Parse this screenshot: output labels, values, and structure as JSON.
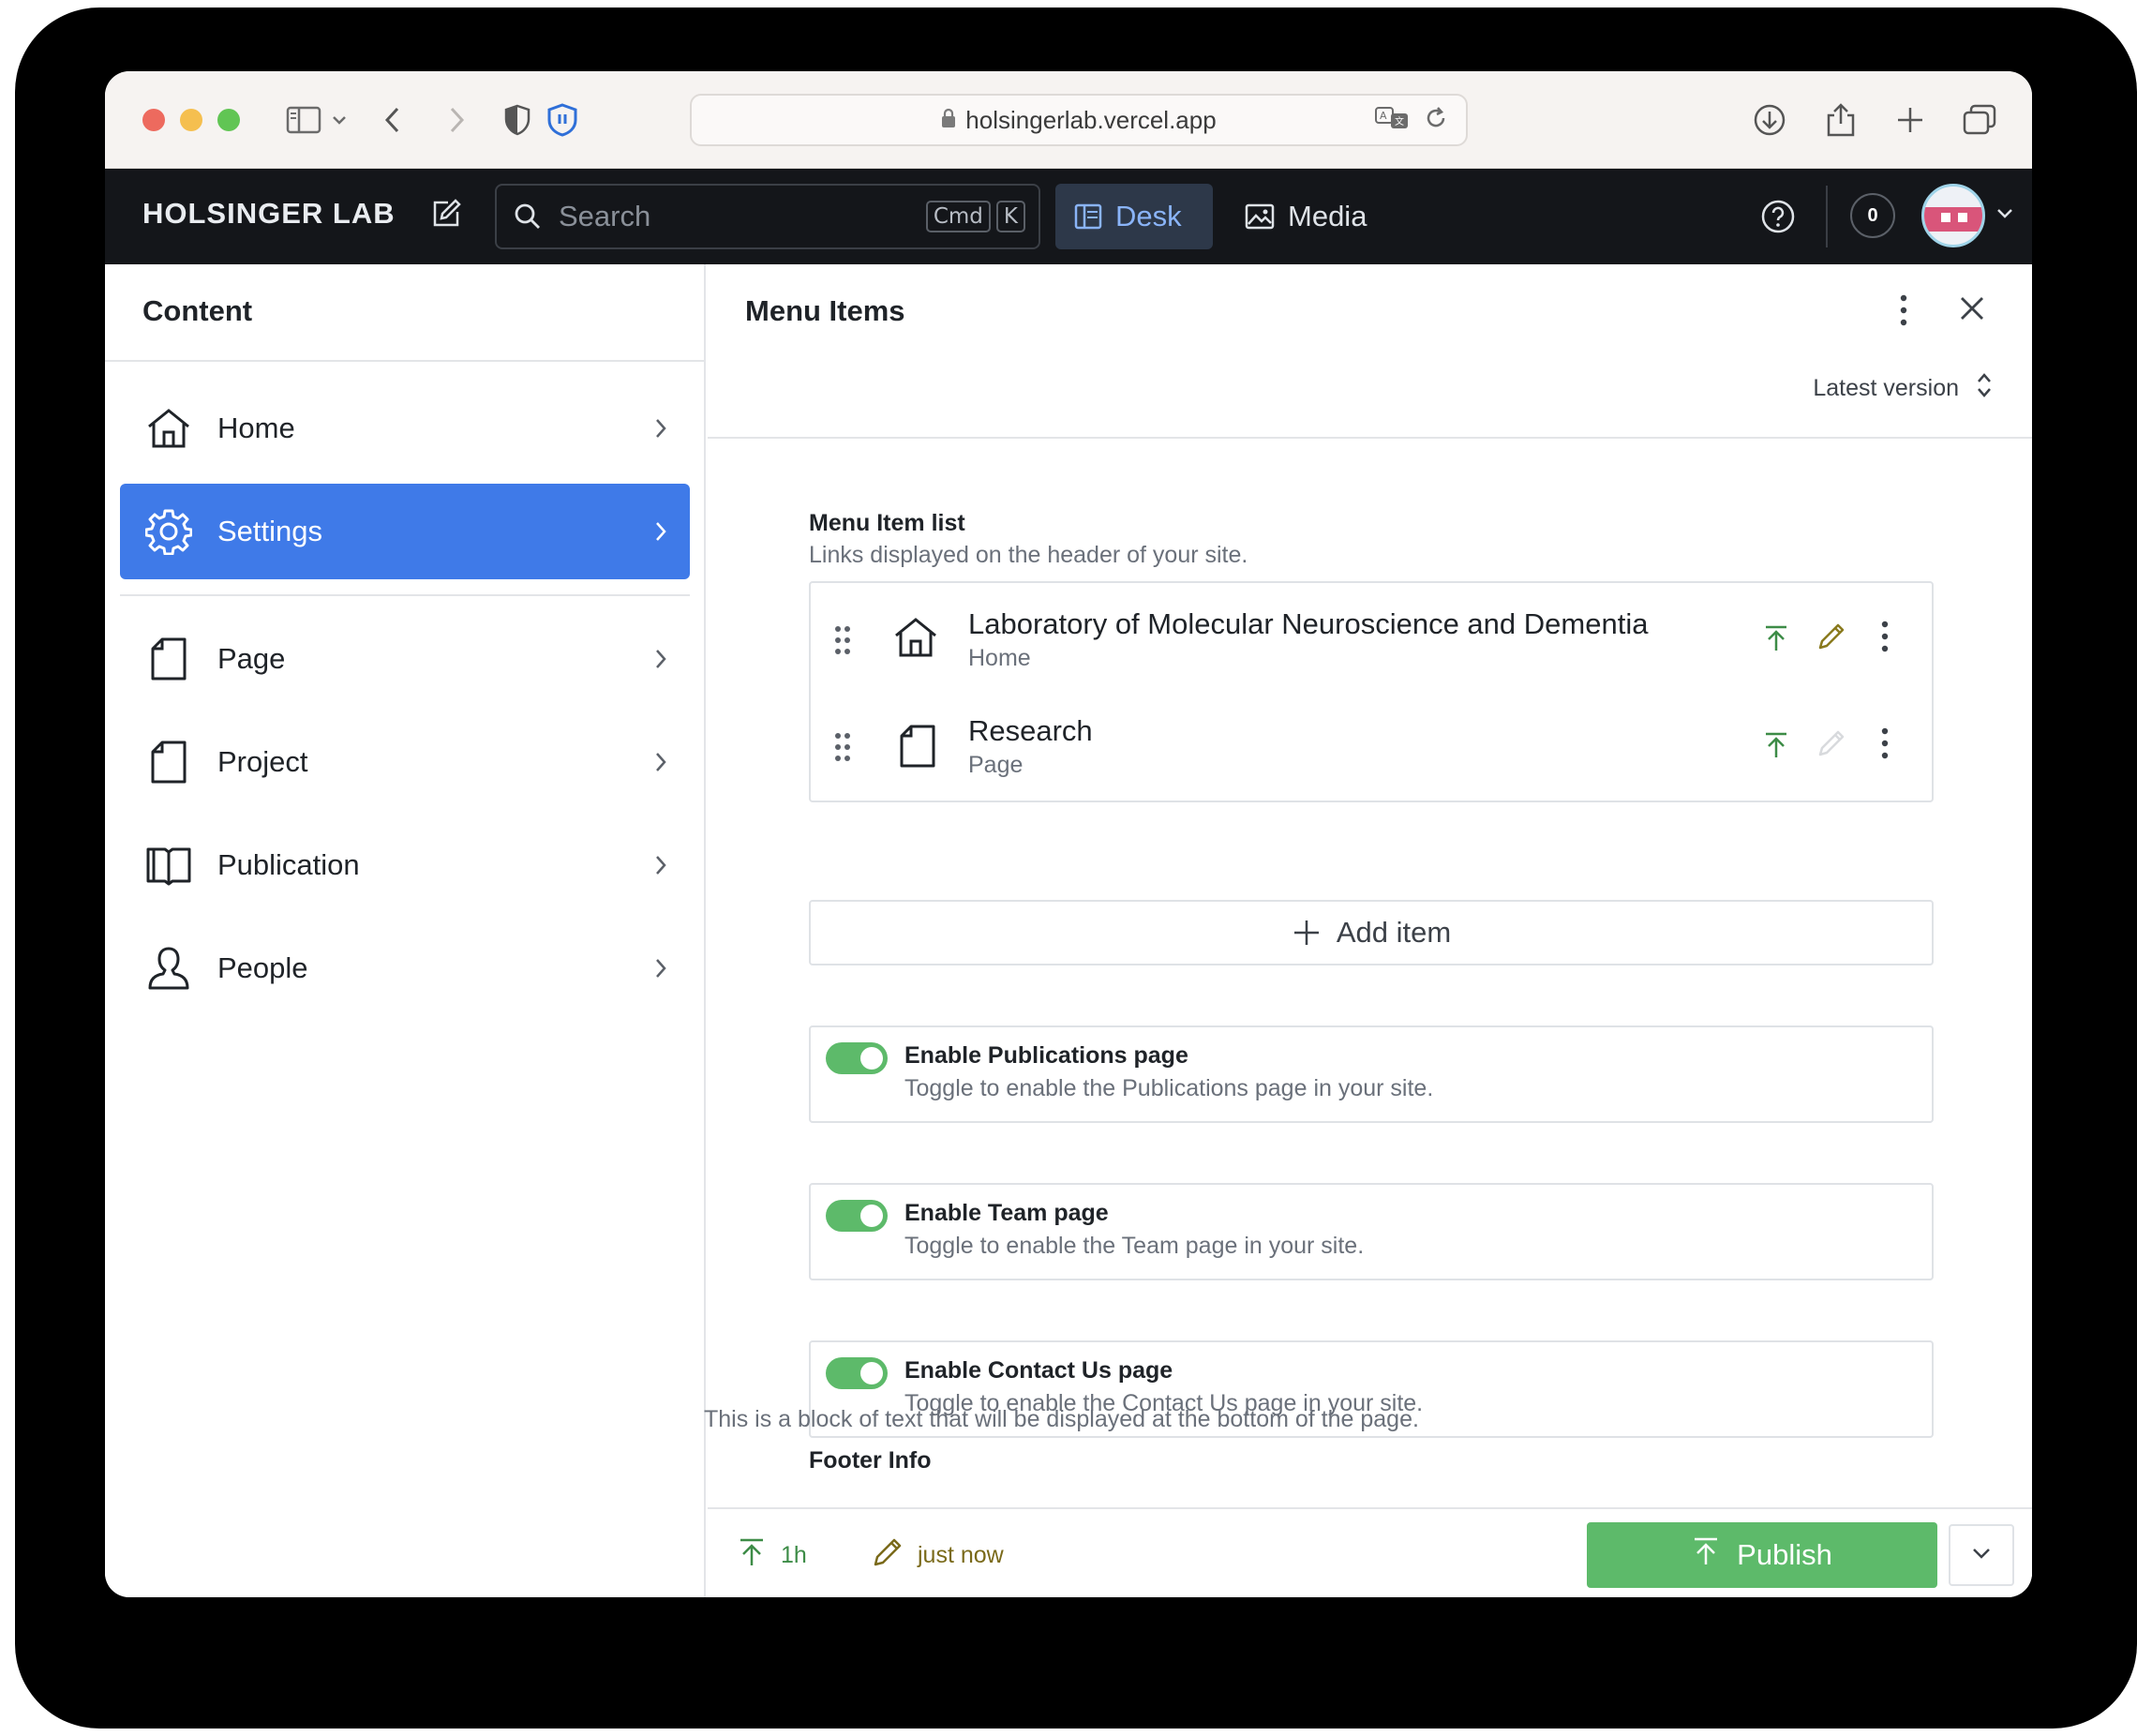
{
  "browser": {
    "url": "holsingerlab.vercel.app"
  },
  "appnav": {
    "brand": "HOLSINGER LAB",
    "search_placeholder": "Search",
    "shortcut_keys": [
      "Cmd",
      "K"
    ],
    "tabs": [
      {
        "label": "Desk",
        "icon": "desk-icon",
        "active": true
      },
      {
        "label": "Media",
        "icon": "image-icon",
        "active": false
      }
    ],
    "notification_count": "0"
  },
  "content_pane": {
    "title": "Content",
    "items": [
      {
        "label": "Home",
        "icon": "home-icon",
        "active": false
      },
      {
        "label": "Settings",
        "icon": "gear-icon",
        "active": true
      },
      {
        "label": "Page",
        "icon": "document-icon",
        "active": false
      },
      {
        "label": "Project",
        "icon": "document-icon",
        "active": false
      },
      {
        "label": "Publication",
        "icon": "book-icon",
        "active": false
      },
      {
        "label": "People",
        "icon": "user-icon",
        "active": false
      }
    ]
  },
  "editor": {
    "title": "Menu Items",
    "version": "Latest version",
    "menu_list": {
      "title": "Menu Item list",
      "description": "Links displayed on the header of your site.",
      "items": [
        {
          "name": "Laboratory of Molecular Neuroscience and Dementia",
          "type": "Home",
          "icon": "home-icon"
        },
        {
          "name": "Research",
          "type": "Page",
          "icon": "document-icon"
        }
      ],
      "add_label": "Add item"
    },
    "toggles": [
      {
        "title": "Enable Publications page",
        "description": "Toggle to enable the Publications page in your site.",
        "enabled": true
      },
      {
        "title": "Enable Team page",
        "description": "Toggle to enable the Team page in your site.",
        "enabled": true
      },
      {
        "title": "Enable Contact Us page",
        "description": "Toggle to enable the Contact Us page in your site.",
        "enabled": true
      }
    ],
    "footer_info": {
      "title": "Footer Info",
      "description": "This is a block of text that will be displayed at the bottom of the page."
    },
    "status": {
      "published": "1h",
      "edited": "just now"
    },
    "publish_label": "Publish"
  },
  "colors": {
    "accent": "#3f7ae8",
    "publish_green": "#5dba6a",
    "nav_bg": "#14161a"
  }
}
